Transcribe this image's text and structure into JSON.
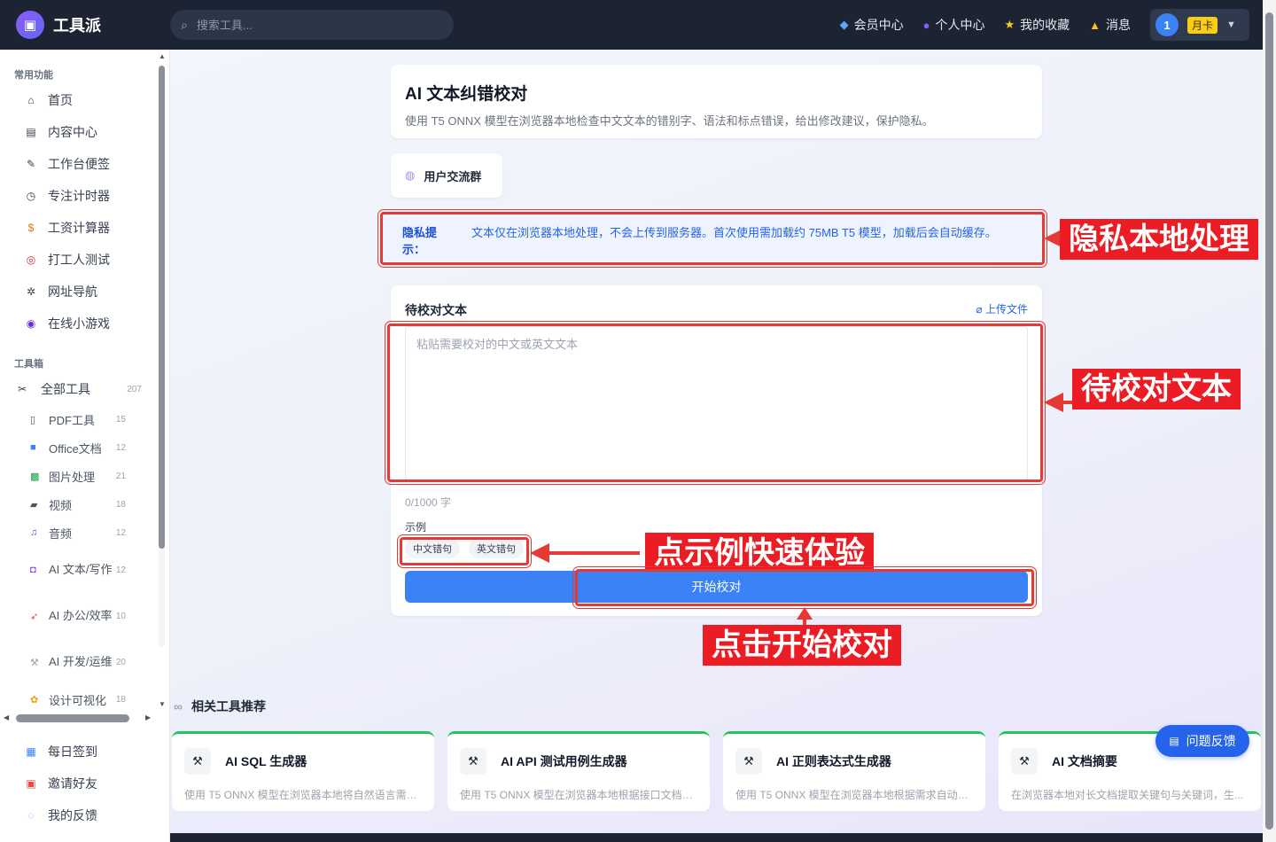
{
  "app": {
    "name": "工具派",
    "logo_icon": "palette-logo-icon"
  },
  "search": {
    "placeholder": "搜索工具..."
  },
  "topnav": {
    "items": [
      {
        "label": "会员中心",
        "icon": "diamond-icon"
      },
      {
        "label": "个人中心",
        "icon": "person-icon"
      },
      {
        "label": "我的收藏",
        "icon": "star-icon"
      },
      {
        "label": "消息",
        "icon": "bell-icon"
      }
    ],
    "user": {
      "avatar": "1",
      "badge": "月卡"
    }
  },
  "sidebar": {
    "common_title": "常用功能",
    "common": [
      {
        "label": "首页",
        "icon": "home-icon"
      },
      {
        "label": "内容中心",
        "icon": "newspaper-icon"
      },
      {
        "label": "工作台便签",
        "icon": "memo-icon"
      },
      {
        "label": "专注计时器",
        "icon": "stopwatch-icon"
      },
      {
        "label": "工资计算器",
        "icon": "money-bag-icon"
      },
      {
        "label": "打工人测试",
        "icon": "target-icon"
      },
      {
        "label": "网址导航",
        "icon": "compass-icon"
      },
      {
        "label": "在线小游戏",
        "icon": "gamepad-icon"
      }
    ],
    "toolbox_title": "工具箱",
    "all_tools": {
      "label": "全部工具",
      "count": "207",
      "icon": "tools-icon"
    },
    "tools": [
      {
        "label": "PDF工具",
        "count": "15",
        "icon": "pdf-icon"
      },
      {
        "label": "Office文档",
        "count": "12",
        "icon": "book-icon"
      },
      {
        "label": "图片处理",
        "count": "21",
        "icon": "image-icon"
      },
      {
        "label": "视频",
        "count": "18",
        "icon": "clapper-icon"
      },
      {
        "label": "音频",
        "count": "12",
        "icon": "music-icon"
      },
      {
        "label": "AI 文本/写作",
        "count": "12",
        "icon": "robot-icon"
      },
      {
        "label": "AI 办公/效率",
        "count": "10",
        "icon": "rocket-icon"
      },
      {
        "label": "AI 开发/运维",
        "count": "20",
        "icon": "wrench-icon"
      },
      {
        "label": "设计可视化",
        "count": "18",
        "icon": "palette-icon"
      }
    ],
    "bottom": [
      {
        "label": "每日签到",
        "icon": "calendar-icon"
      },
      {
        "label": "邀请好友",
        "icon": "gift-icon"
      },
      {
        "label": "我的反馈",
        "icon": "chat-icon"
      }
    ]
  },
  "header": {
    "title": "AI 文本纠错校对",
    "description": "使用 T5 ONNX 模型在浏览器本地检查中文文本的错别字、语法和标点错误，给出修改建议，保护隐私。"
  },
  "group": {
    "label": "用户交流群"
  },
  "privacy": {
    "label": "隐私提示：",
    "text": "文本仅在浏览器本地处理，不会上传到服务器。首次使用需加载约 75MB T5 模型，加载后会自动缓存。"
  },
  "form": {
    "label": "待校对文本",
    "upload": "上传文件",
    "placeholder": "粘贴需要校对的中文或英文文本",
    "value": "",
    "counter": "0/1000 字",
    "examples_label": "示例",
    "examples": [
      "中文错句",
      "英文错句"
    ],
    "submit": "开始校对"
  },
  "related": {
    "title": "相关工具推荐",
    "items": [
      {
        "name": "AI SQL 生成器",
        "desc": "使用 T5 ONNX 模型在浏览器本地将自然语言需求..."
      },
      {
        "name": "AI API 测试用例生成器",
        "desc": "使用 T5 ONNX 模型在浏览器本地根据接口文档生..."
      },
      {
        "name": "AI 正则表达式生成器",
        "desc": "使用 T5 ONNX 模型在浏览器本地根据需求自动生..."
      },
      {
        "name": "AI 文档摘要",
        "desc": "在浏览器本地对长文档提取关键句与关键词，生..."
      }
    ]
  },
  "feedback": {
    "label": "问题反馈"
  },
  "annotations": {
    "privacy": "隐私本地处理",
    "textarea": "待校对文本",
    "examples": "点示例快速体验",
    "submit": "点击开始校对"
  },
  "colors": {
    "accent": "#3b82f6",
    "annotation": "#ec1c24",
    "topbar": "#1c2434"
  }
}
